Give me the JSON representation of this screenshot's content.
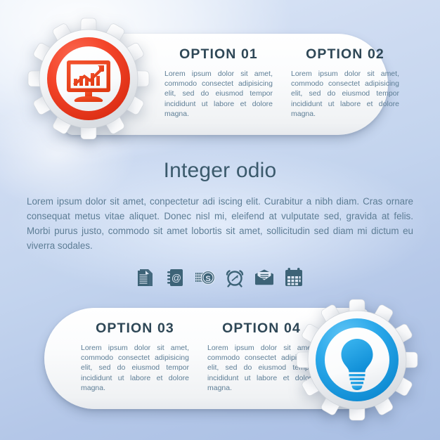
{
  "theme": {
    "background_top": "#dfeaf8",
    "background_bottom": "#a9bfe4",
    "heading_color": "#2e4756",
    "body_text_color": "#5e7e96",
    "panel_color": "#ffffff",
    "accent_red": "#ef3b24",
    "accent_blue": "#2ba6e8",
    "icon_color": "#3d6377"
  },
  "top_panel": {
    "options": [
      {
        "title": "OPTION 01",
        "body": "Lorem ipsum dolor sit amet, commodo consectet adipisicing elit, sed do eiusmod tempor incididunt ut labore et dolore magna."
      },
      {
        "title": "OPTION 02",
        "body": "Lorem ipsum dolor sit amet, commodo consectet adipisicing elit, sed do eiusmod tempor incididunt ut labore et dolore magna."
      }
    ],
    "gear": {
      "icon": "monitor-chart-icon",
      "ring_color": "#ef3b24"
    }
  },
  "bottom_panel": {
    "options": [
      {
        "title": "OPTION 03",
        "body": "Lorem ipsum dolor sit amet, commodo consectet adipisicing elit, sed do eiusmod tempor incididunt ut labore et dolore magna."
      },
      {
        "title": "OPTION 04",
        "body": "Lorem ipsum dolor sit amet, commodo consectet adipisicing elit, sed do eiusmod tempor incididunt ut labore et dolore magna."
      }
    ],
    "gear": {
      "icon": "lightbulb-icon",
      "ring_color": "#2ba6e8"
    }
  },
  "middle": {
    "title": "Integer odio",
    "paragraph_line1": "Lorem ipsum dolor sit amet, conpectetur adi  iscing elit. Curabitur a nibh diam.",
    "paragraph_line2": "Cras ornare consequat metus vitae aliquet. Donec nisl mi, eleifend at",
    "paragraph_line3": "vulputate sed, gravida at felis. Morbi purus justo, commodo sit amet lobortis",
    "paragraph_line4": "sit amet, sollicitudin sed diam mi dictum eu viverra sodales.",
    "icons": [
      {
        "name": "document-icon",
        "label": "Documents"
      },
      {
        "name": "address-book-at-icon",
        "label": "Contacts"
      },
      {
        "name": "money-coin-icon",
        "label": "Finance"
      },
      {
        "name": "alarm-clock-icon",
        "label": "Time"
      },
      {
        "name": "envelope-message-icon",
        "label": "Mail"
      },
      {
        "name": "calendar-icon",
        "label": "Calendar"
      }
    ]
  }
}
